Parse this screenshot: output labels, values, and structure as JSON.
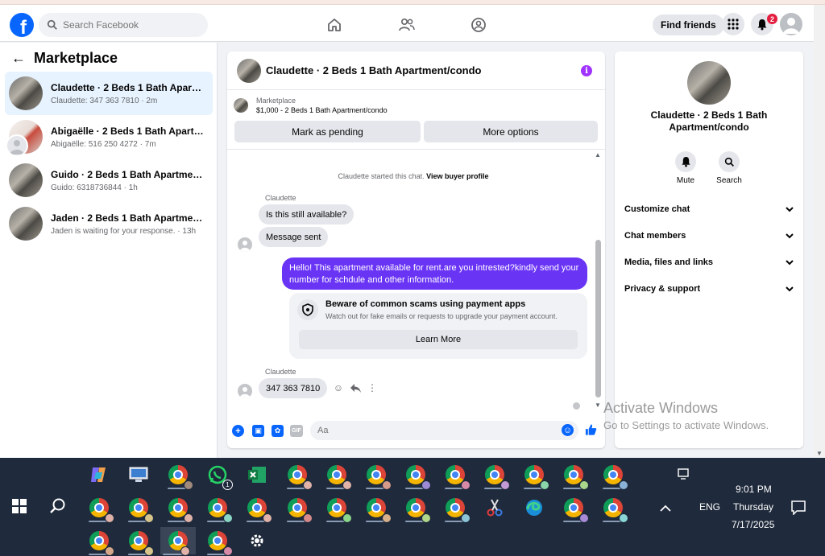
{
  "navbar": {
    "search_placeholder": "Search Facebook",
    "find_friends": "Find friends",
    "notif_count": "2",
    "logo_letter": "f"
  },
  "sidebar": {
    "title": "Marketplace",
    "items": [
      {
        "title": "Claudette · 2 Beds 1 Bath Apartment/condo",
        "sub": "Claudette: 347 363 7810 · 2m",
        "active": true
      },
      {
        "title": "Abigaëlle · 2 Beds 1 Bath Apartment/condo",
        "sub": "Abigaëlle: 516 250 4272 · 7m"
      },
      {
        "title": "Guido · 2 Beds 1 Bath Apartment/condo",
        "sub": "Guido: 6318736844 · 1h"
      },
      {
        "title": "Jaden · 2 Beds 1 Bath Apartment/condo",
        "sub": "Jaden is waiting for your response. · 13h"
      }
    ]
  },
  "chat": {
    "header_name": "Claudette · 2 Beds 1 Bath Apartment/condo",
    "marketplace_label": "Marketplace",
    "listing": "$1,000 - 2 Beds 1 Bath Apartment/condo",
    "mark_pending": "Mark as pending",
    "more_options": "More options",
    "started_text": "Claudette started this chat.",
    "view_profile": "View buyer profile",
    "sender_name": "Claudette",
    "msg1": "Is this still available?",
    "msg2": "Message sent",
    "outgoing": "Hello! This apartment available for rent.are you intrested?kindly send your number for schdule and other information.",
    "scam_title": "Beware of common scams using payment apps",
    "scam_sub": "Watch out for fake emails or requests to upgrade your payment account.",
    "learn_more": "Learn More",
    "sender_name2": "Claudette",
    "msg3": "347 363 7810",
    "composer_placeholder": "Aa"
  },
  "right": {
    "name": "Claudette · 2 Beds 1 Bath Apartment/condo",
    "mute": "Mute",
    "search": "Search",
    "rows": [
      "Customize chat",
      "Chat members",
      "Media, files and links",
      "Privacy & support"
    ]
  },
  "watermark": {
    "line1": "Activate Windows",
    "line2": "Go to Settings to activate Windows."
  },
  "taskbar": {
    "lang": "ENG",
    "time": "9:01 PM",
    "day": "Thursday",
    "date": "7/17/2025",
    "whatsapp_badge": "1"
  }
}
